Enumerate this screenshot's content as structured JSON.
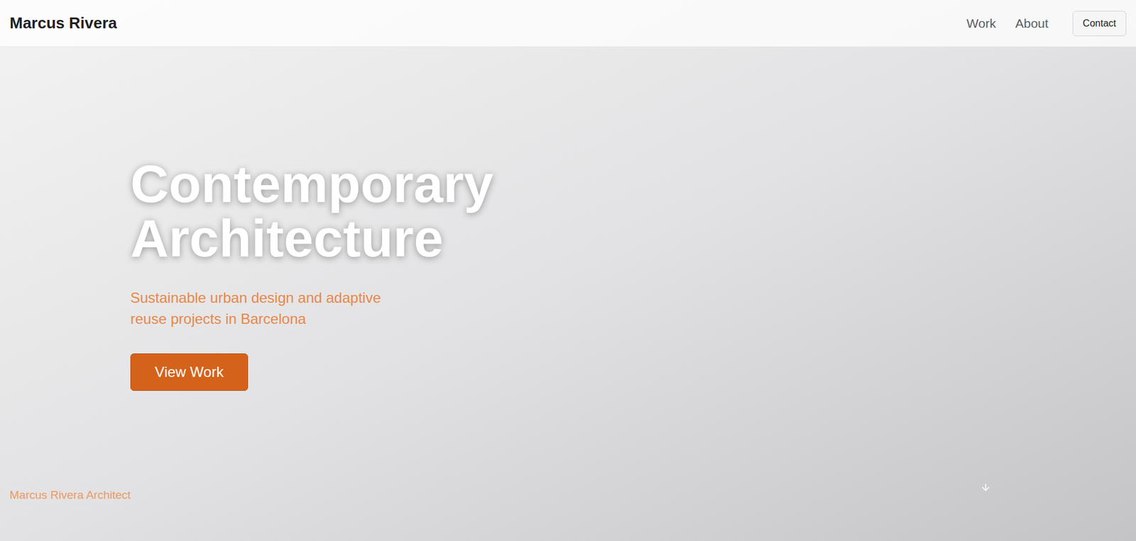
{
  "header": {
    "brand": "Marcus Rivera",
    "nav": [
      {
        "label": "Work"
      },
      {
        "label": "About"
      }
    ],
    "cta": "Contact"
  },
  "hero": {
    "title_lines": [
      "Contemporary",
      "Architecture"
    ],
    "subtitle": "Sustainable urban design and adaptive reuse projects in Barcelona",
    "button": "View Work"
  },
  "footer": {
    "caption": "Marcus Rivera Architect"
  }
}
